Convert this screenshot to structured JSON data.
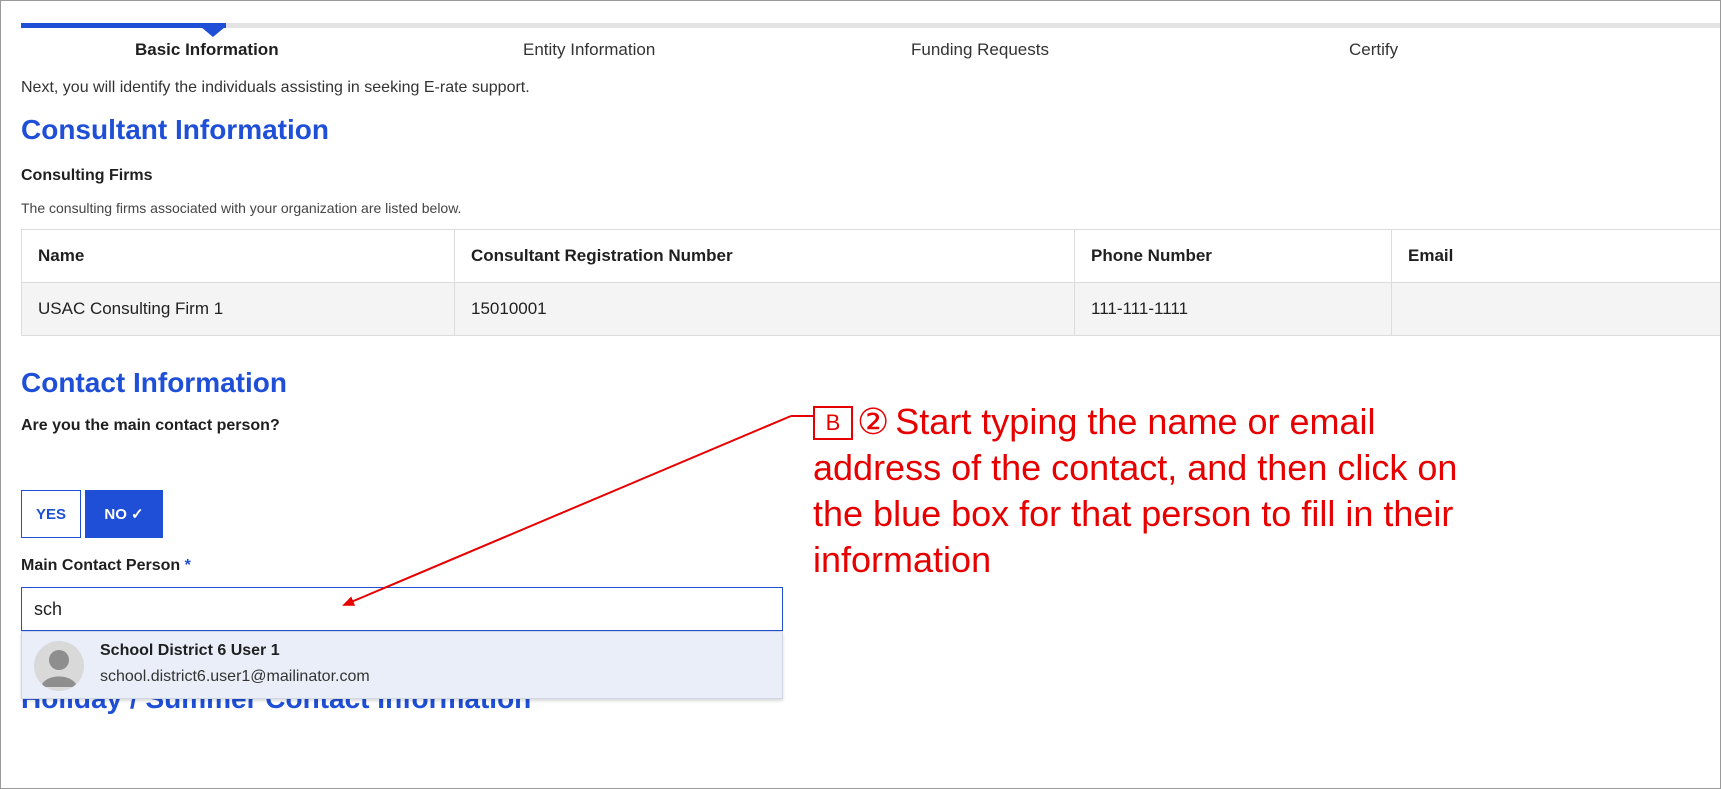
{
  "steps": [
    "Basic Information",
    "Entity Information",
    "Funding Requests",
    "Certify"
  ],
  "intro": "Next, you will identify the individuals assisting in seeking E-rate support.",
  "consultant": {
    "heading": "Consultant Information",
    "firms_title": "Consulting Firms",
    "firms_note": "The consulting firms associated with your organization are listed below.",
    "columns": [
      "Name",
      "Consultant Registration Number",
      "Phone Number",
      "Email"
    ],
    "rows": [
      [
        "USAC Consulting Firm 1",
        "15010001",
        "111-111-1111",
        ""
      ]
    ]
  },
  "contact": {
    "heading": "Contact Information",
    "question": "Are you the main contact person?",
    "yes_label": "YES",
    "no_label": "NO ✓",
    "main_label": "Main Contact Person",
    "required_mark": "*",
    "search_value": "sch",
    "suggestion": {
      "name": "School District 6 User 1",
      "email": "school.district6.user1@mailinator.com"
    }
  },
  "holiday_heading": "Holiday / Summer Contact Information",
  "annotation": {
    "badge": "B",
    "circle": "②",
    "text": "Start typing the name or email address of the contact, and then click on the blue box for that person to fill in their information"
  },
  "colors": {
    "accent": "#1f4fd6",
    "annotation": "#e60000"
  },
  "icons": [
    "user-avatar-icon",
    "checkmark-icon"
  ]
}
